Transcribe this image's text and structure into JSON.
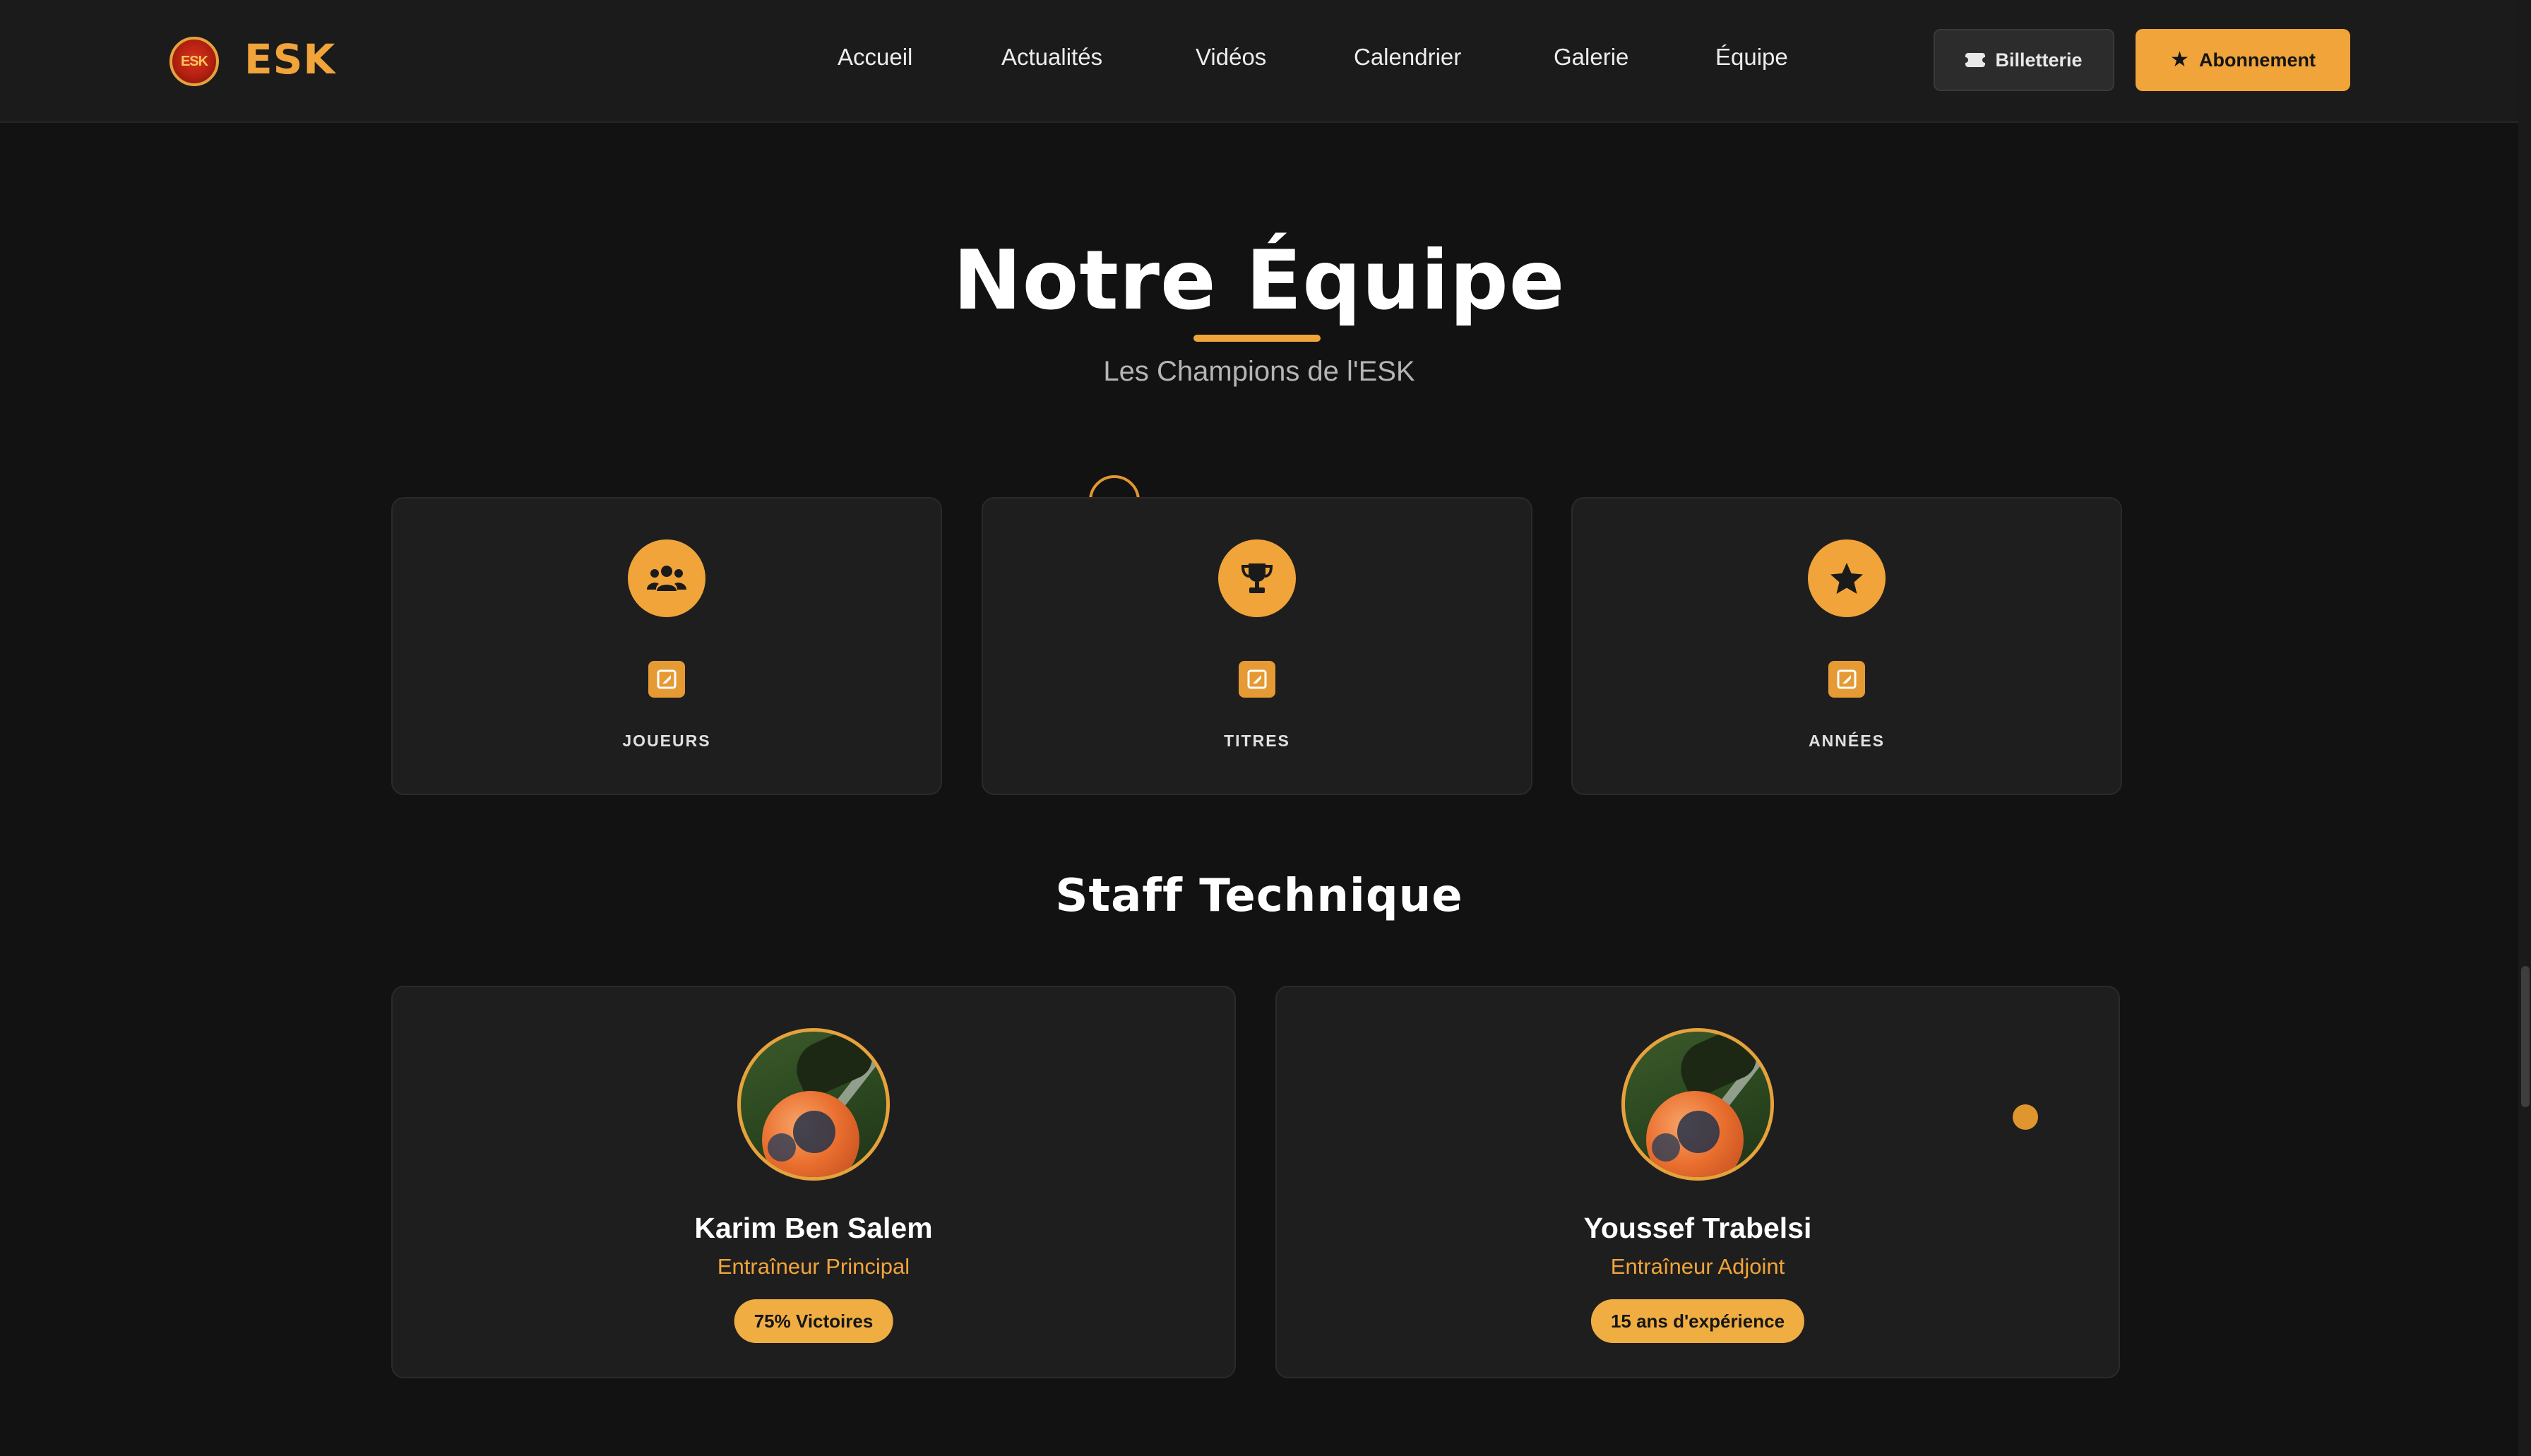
{
  "brand": {
    "badge_text": "ESK",
    "name": "ESK"
  },
  "nav": {
    "links": [
      "Accueil",
      "Actualités",
      "Vidéos",
      "Calendrier",
      "Galerie",
      "Équipe"
    ],
    "ticket_button": "Billetterie",
    "subscribe_button": "Abonnement"
  },
  "hero": {
    "title": "Notre Équipe",
    "subtitle": "Les Champions de l'ESK"
  },
  "stats": [
    {
      "icon": "users-icon",
      "label": "JOUEURS"
    },
    {
      "icon": "trophy-icon",
      "label": "TITRES"
    },
    {
      "icon": "star-icon",
      "label": "ANNÉES"
    }
  ],
  "staff": {
    "heading": "Staff Technique",
    "members": [
      {
        "name": "Karim Ben Salem",
        "role": "Entraîneur Principal",
        "badge": "75% Victoires"
      },
      {
        "name": "Youssef Trabelsi",
        "role": "Entraîneur Adjoint",
        "badge": "15 ans d'expérience"
      }
    ]
  },
  "colors": {
    "accent": "#f0a43a",
    "background": "#121212",
    "card": "#1e1e1e",
    "nav": "#1b1b1b"
  }
}
